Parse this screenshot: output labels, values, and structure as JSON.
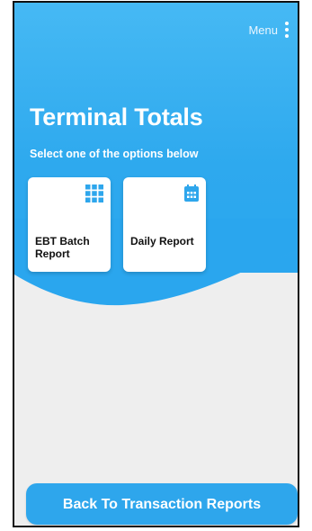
{
  "menu": {
    "label": "Menu",
    "icon": "more-vert-icon"
  },
  "header": {
    "title": "Terminal Totals",
    "subtitle": "Select one of the options below"
  },
  "cards": [
    {
      "label": "EBT Batch Report",
      "icon": "grid-icon"
    },
    {
      "label": "Daily Report",
      "icon": "calendar-icon"
    }
  ],
  "footer": {
    "back_label": "Back To Transaction Reports"
  },
  "colors": {
    "accent": "#2ea6ec",
    "background": "#eeeeee",
    "card": "#ffffff"
  }
}
